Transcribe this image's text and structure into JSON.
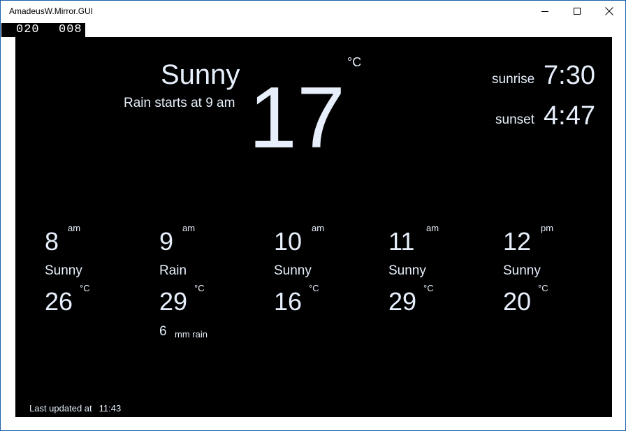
{
  "window": {
    "title": "AmadeusW.Mirror.GUI"
  },
  "frame_counter": [
    "020",
    "008"
  ],
  "current": {
    "condition": "Sunny",
    "note": "Rain starts at 9 am",
    "temperature": "17",
    "unit": "°C"
  },
  "sun": {
    "sunrise_label": "sunrise",
    "sunrise_time": "7:30",
    "sunset_label": "sunset",
    "sunset_time": "4:47"
  },
  "forecast": [
    {
      "hour": "8",
      "ampm": "am",
      "condition": "Sunny",
      "temp": "26",
      "unit": "°C"
    },
    {
      "hour": "9",
      "ampm": "am",
      "condition": "Rain",
      "temp": "29",
      "unit": "°C",
      "rain_amount": "6",
      "rain_unit": "mm rain"
    },
    {
      "hour": "10",
      "ampm": "am",
      "condition": "Sunny",
      "temp": "16",
      "unit": "°C"
    },
    {
      "hour": "11",
      "ampm": "am",
      "condition": "Sunny",
      "temp": "29",
      "unit": "°C"
    },
    {
      "hour": "12",
      "ampm": "pm",
      "condition": "Sunny",
      "temp": "20",
      "unit": "°C"
    }
  ],
  "footer": {
    "label": "Last updated at",
    "time": "11:43"
  },
  "colors": {
    "text": "#e6effb",
    "background": "#000000",
    "window_border": "#1b5fa8"
  }
}
